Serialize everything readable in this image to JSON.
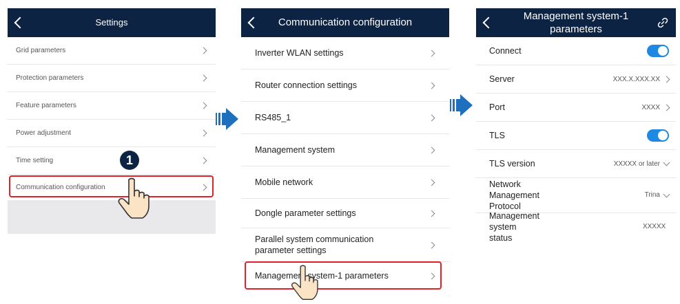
{
  "screen1": {
    "title": "Settings",
    "items": [
      {
        "label": "Grid parameters"
      },
      {
        "label": "Protection parameters"
      },
      {
        "label": "Feature parameters"
      },
      {
        "label": "Power adjustment"
      },
      {
        "label": "Time setting"
      },
      {
        "label": "Communication configuration"
      }
    ],
    "step_badge": "1"
  },
  "screen2": {
    "title": "Communication configuration",
    "items": [
      {
        "label": "Inverter WLAN settings"
      },
      {
        "label": "Router connection settings"
      },
      {
        "label": "RS485_1"
      },
      {
        "label": "Management system"
      },
      {
        "label": "Mobile network"
      },
      {
        "label": "Dongle parameter settings"
      },
      {
        "label": "Parallel system communication parameter settings"
      },
      {
        "label": "Management system-1 parameters"
      }
    ]
  },
  "screen3": {
    "title": "Management system-1 parameters",
    "rows": [
      {
        "label": "Connect",
        "value": "",
        "control": "toggle-on"
      },
      {
        "label": "Server",
        "value": "XXX.X.XXX.XX",
        "control": "chevron-right"
      },
      {
        "label": "Port",
        "value": "XXXX",
        "control": "chevron-right"
      },
      {
        "label": "TLS",
        "value": "",
        "control": "toggle-on"
      },
      {
        "label": "TLS version",
        "value": "XXXXX or later",
        "control": "chevron-down"
      },
      {
        "label": "Network Management Protocol",
        "value": "Trina",
        "control": "chevron-down"
      },
      {
        "label": "Management system status",
        "value": "XXXXX",
        "control": "none"
      }
    ]
  },
  "colors": {
    "header": "#0d2343",
    "highlight": "#e0202a",
    "toggle": "#1e88e5",
    "arrow": "#1f6fbf"
  }
}
